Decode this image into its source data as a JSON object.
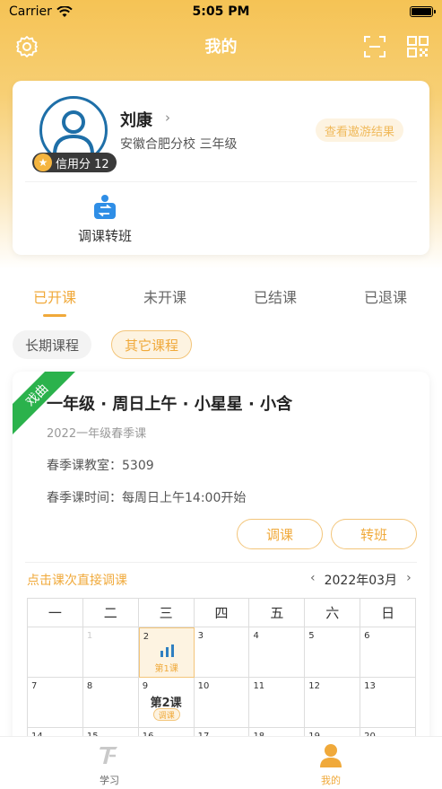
{
  "status_bar": {
    "carrier": "Carrier",
    "time": "5:05 PM"
  },
  "nav": {
    "title": "我的"
  },
  "profile": {
    "name": "刘康",
    "name_arrow": "›",
    "school": "安徽合肥分校  三年级",
    "credit": "信用分 12",
    "tour_button": "查看遨游结果",
    "transfer_label": "调课转班"
  },
  "status_tabs": [
    "已开课",
    "未开课",
    "已结课",
    "已退课"
  ],
  "course_types": [
    "长期课程",
    "其它课程"
  ],
  "course": {
    "ribbon": "戏曲",
    "title": "一年级 · 周日上午 · 小星星 · 小含",
    "term": "2022一年级春季课",
    "room": "春季课教室：5309",
    "time": "春季课时间：每周日上午14:00开始",
    "button_adjust": "调课",
    "button_transfer": "转班"
  },
  "calendar": {
    "hint": "点击课次直接调课",
    "prev": "‹",
    "month": "2022年03月",
    "next": "›",
    "weekdays": [
      "一",
      "二",
      "三",
      "四",
      "五",
      "六",
      "日"
    ],
    "week1": [
      "",
      "1",
      "2",
      "3",
      "4",
      "5",
      "6"
    ],
    "week2": [
      "7",
      "8",
      "9",
      "10",
      "11",
      "12",
      "13"
    ],
    "week3": [
      "14",
      "15",
      "16",
      "17",
      "18",
      "19",
      "20"
    ],
    "lesson1_note": "第1课",
    "lesson2_title": "第2课",
    "lesson2_tag": "调课"
  },
  "tabbar": {
    "study": "学习",
    "mine": "我的"
  },
  "colors": {
    "accent": "#f0a93a",
    "ribbon": "#2bb24c",
    "avatar_ring": "#1e6fa8"
  }
}
